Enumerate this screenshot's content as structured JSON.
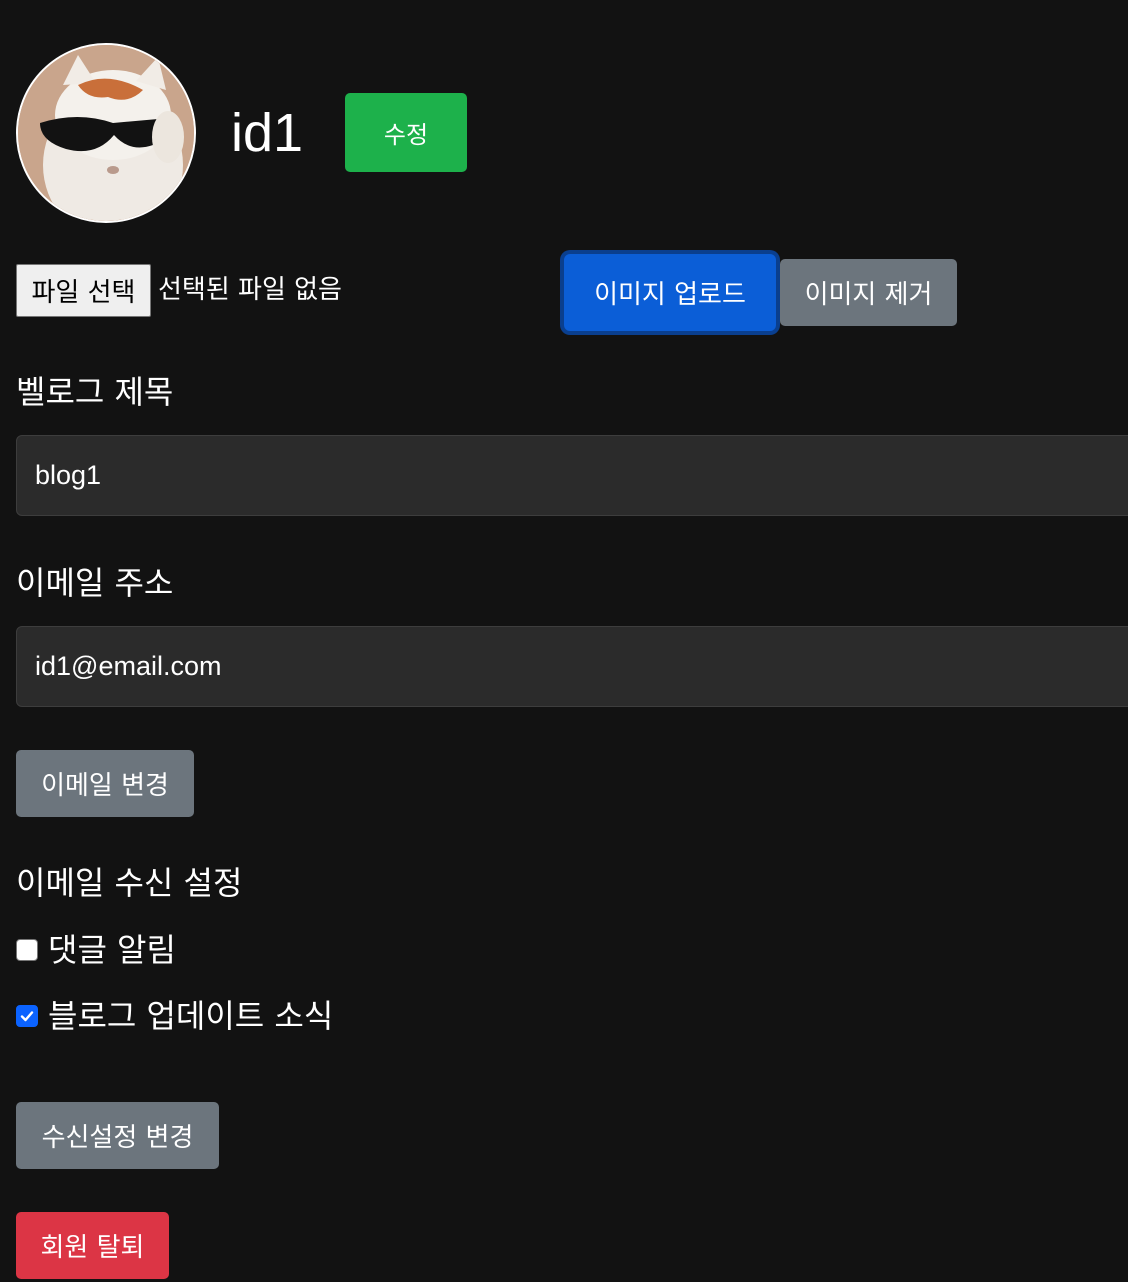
{
  "profile": {
    "username": "id1",
    "edit_label": "수정"
  },
  "image": {
    "file_button_label": "파일 선택",
    "file_status": "선택된 파일 없음",
    "upload_label": "이미지 업로드",
    "remove_label": "이미지 제거"
  },
  "blog_title": {
    "label": "벨로그 제목",
    "value": "blog1"
  },
  "email": {
    "label": "이메일 주소",
    "value": "id1@email.com",
    "change_label": "이메일 변경"
  },
  "notifications": {
    "label": "이메일 수신 설정",
    "items": [
      {
        "label": "댓글 알림",
        "checked": false
      },
      {
        "label": "블로그 업데이트 소식",
        "checked": true
      }
    ],
    "save_label": "수신설정 변경"
  },
  "account": {
    "withdraw_label": "회원 탈퇴"
  },
  "colors": {
    "background": "#121212",
    "edit_button": "#1db14b",
    "primary": "#0b5ed7",
    "secondary": "#6c757d",
    "danger": "#dc3545"
  }
}
